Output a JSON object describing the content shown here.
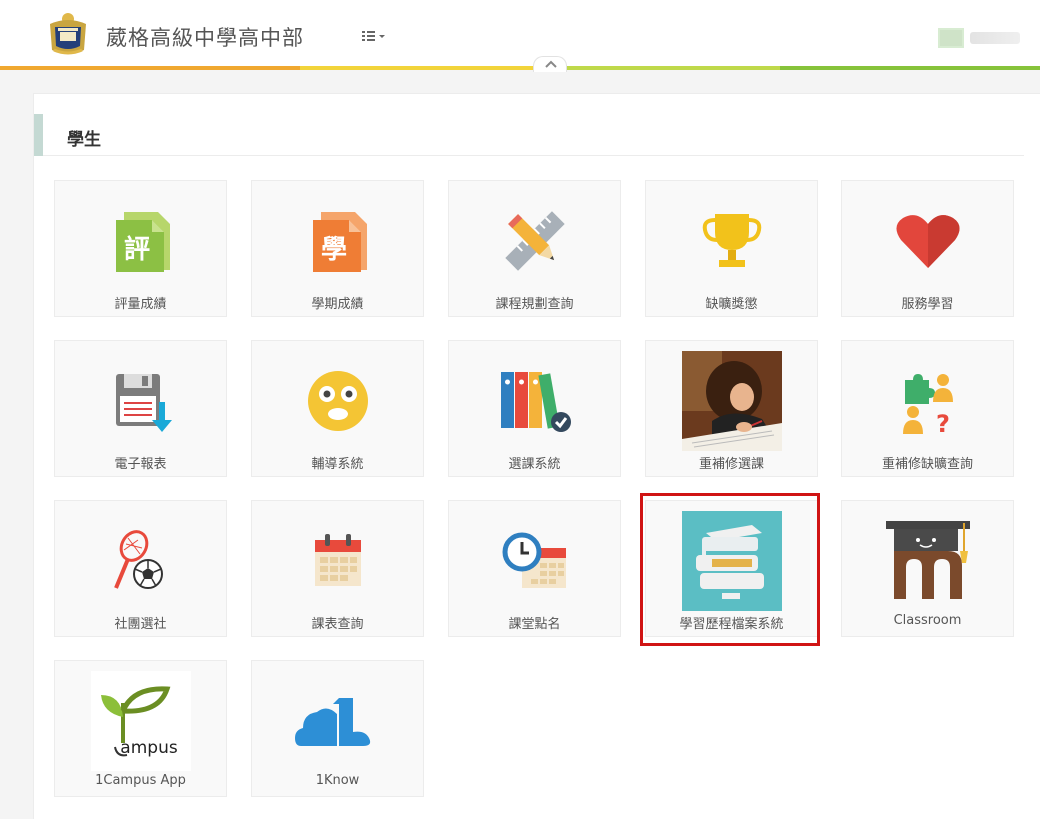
{
  "header": {
    "school_name": "葳格高級中學高中部",
    "logo_icon": "school-crest-icon",
    "menu_icon": "grid-menu-icon",
    "collapse_icon": "chevron-up-icon"
  },
  "colors": {
    "bar_orange": "#f0a830",
    "bar_yellow": "#f2d43a",
    "bar_lightgreen": "#bfd94a",
    "bar_green": "#86c33a",
    "highlight": "#d01414",
    "section_accent": "#c4d9d3"
  },
  "section": {
    "title": "學生"
  },
  "tiles": [
    {
      "label": "評量成績",
      "icon": "grade-doc-icon"
    },
    {
      "label": "學期成績",
      "icon": "semester-doc-icon"
    },
    {
      "label": "課程規劃查詢",
      "icon": "pencil-ruler-icon"
    },
    {
      "label": "缺曠獎懲",
      "icon": "trophy-icon"
    },
    {
      "label": "服務學習",
      "icon": "heart-icon"
    },
    {
      "label": "電子報表",
      "icon": "floppy-download-icon"
    },
    {
      "label": "輔導系統",
      "icon": "smiley-face-icon"
    },
    {
      "label": "選課系統",
      "icon": "binders-check-icon"
    },
    {
      "label": "重補修選課",
      "icon": "student-writing-photo"
    },
    {
      "label": "重補修缺曠查詢",
      "icon": "puzzle-people-question-icon"
    },
    {
      "label": "社團選社",
      "icon": "racket-ball-icon"
    },
    {
      "label": "課表查詢",
      "icon": "calendar-icon"
    },
    {
      "label": "課堂點名",
      "icon": "clock-calendar-icon"
    },
    {
      "label": "學習歷程檔案系統",
      "icon": "books-graduation-icon"
    },
    {
      "label": "Classroom",
      "icon": "graduation-m-icon"
    },
    {
      "label": "1Campus App",
      "icon": "campus-tree-logo"
    },
    {
      "label": "1Know",
      "icon": "cloud-one-icon"
    }
  ]
}
